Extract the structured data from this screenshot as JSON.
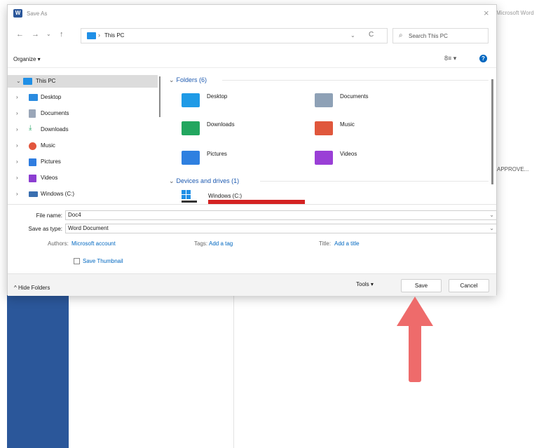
{
  "word": {
    "title": "Microsoft Word",
    "approve": "APPROVE..."
  },
  "dialog": {
    "title": "Save As",
    "icons": {
      "back": "←",
      "forward": "→",
      "recent": "⌄",
      "up": "↑",
      "search": "⌕",
      "refresh": "C"
    },
    "address": {
      "sep": "›",
      "path": "This PC",
      "dropdown": "⌄"
    },
    "search_placeholder": "Search This PC",
    "organize": "Organize ▾",
    "view": "8≡ ▾",
    "help": "?",
    "nav_items": [
      {
        "label": "This PC",
        "chev": "⌄",
        "color": "#1f8fe6"
      },
      {
        "label": "Desktop",
        "chev": "›",
        "color": "#2a8be0"
      },
      {
        "label": "Documents",
        "chev": "›",
        "color": "#9aa6b8"
      },
      {
        "label": "Downloads",
        "chev": "›",
        "color": "#2aa86a"
      },
      {
        "label": "Music",
        "chev": "›",
        "color": "#e2563d"
      },
      {
        "label": "Pictures",
        "chev": "›",
        "color": "#2f7de0"
      },
      {
        "label": "Videos",
        "chev": "›",
        "color": "#8c3ed1"
      },
      {
        "label": "Windows (C:)",
        "chev": "›",
        "color": "#3a6fb0"
      }
    ],
    "folders_header": "Folders (6)",
    "folders": [
      {
        "label": "Desktop",
        "color": "#1f9ae6"
      },
      {
        "label": "Documents",
        "color": "#8ea1b6"
      },
      {
        "label": "Downloads",
        "color": "#22a65f"
      },
      {
        "label": "Music",
        "color": "#e0573c"
      },
      {
        "label": "Pictures",
        "color": "#2f80e0"
      },
      {
        "label": "Videos",
        "color": "#9a3fd6"
      }
    ],
    "devices_header": "Devices and drives (1)",
    "drive_label": "Windows (C:)",
    "file_name_label": "File name:",
    "file_name_value": "Doc4",
    "save_type_label": "Save as type:",
    "save_type_value": "Word Document",
    "authors_label": "Authors:",
    "authors_value": "Microsoft account",
    "tags_label": "Tags:",
    "tags_value": "Add a tag",
    "title_label": "Title:",
    "title_value": "Add a title",
    "thumbnail_label": "Save Thumbnail",
    "hide_folders": "^ Hide Folders",
    "tools": "Tools  ▾",
    "save": "Save",
    "cancel": "Cancel"
  }
}
